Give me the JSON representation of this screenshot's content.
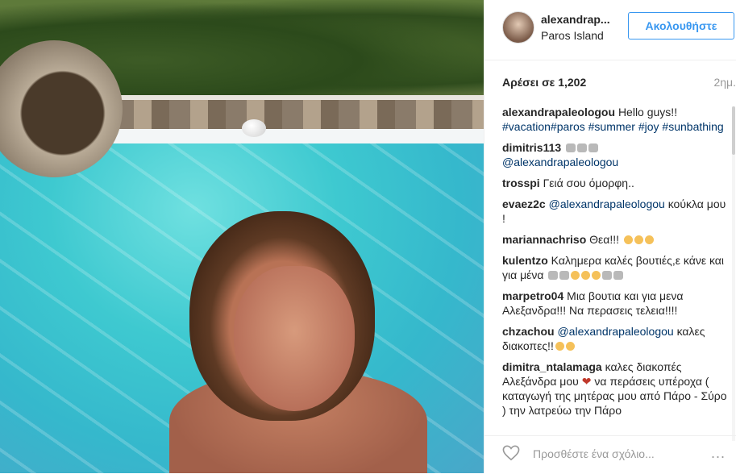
{
  "post": {
    "username": "alexandrap...",
    "location": "Paros Island",
    "follow_label": "Ακολουθήστε",
    "likes_label": "Αρέσει σε 1,202",
    "time": "2ημ."
  },
  "comments": [
    {
      "user": "alexandrapaleologou",
      "parts": [
        "Hello guys!!"
      ],
      "tags": "#vacation#paros #summer #joy #sunbathing"
    },
    {
      "user": "dimitris113",
      "text_after_emoji": "@alexandrapaleologou"
    },
    {
      "user": "trosspi",
      "text": "Γειά σου όμορφη.."
    },
    {
      "user": "evaez2c",
      "mention": "@alexandrapaleologou",
      "text": "κούκλα μου !"
    },
    {
      "user": "mariannachriso",
      "text": "Θεα!!!"
    },
    {
      "user": "kulentzo",
      "text": "Καλημερα καλές βουτιές,ε κάνε και για μένα"
    },
    {
      "user": "marpetro04",
      "text": "Μια βουτια και για μενα Αλεξανδρα!!! Να περασεις τελεια!!!!"
    },
    {
      "user": "chzachou",
      "mention": "@alexandrapaleologou",
      "text": "καλες διακοπες!!"
    },
    {
      "user": "dimitra_ntalamaga",
      "text1": "καλες διακοπές Αλεξάνδρα μου",
      "text2": "να περάσεις υπέροχα ( καταγωγή της μητέρας μου από Πάρο - Σύρο ) την λατρεύω την Πάρο"
    }
  ],
  "footer": {
    "comment_placeholder": "Προσθέστε ένα σχόλιο...",
    "more_label": "..."
  },
  "icons": {
    "heart": "heart-outline-icon",
    "more": "more-options-icon"
  },
  "colors": {
    "accent": "#3897f0",
    "tag": "#003569",
    "muted": "#999999"
  }
}
